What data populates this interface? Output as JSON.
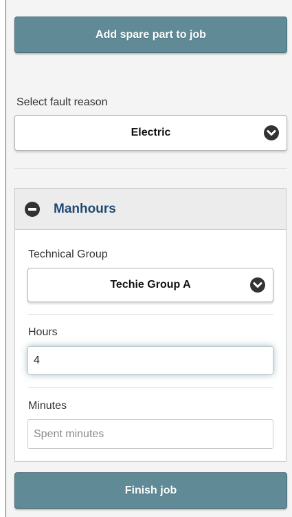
{
  "buttons": {
    "add_spare_part": "Add spare part to job",
    "finish_job": "Finish job"
  },
  "fault_reason": {
    "label": "Select fault reason",
    "selected": "Electric"
  },
  "manhours": {
    "title": "Manhours",
    "technical_group": {
      "label": "Technical Group",
      "selected": "Techie Group A"
    },
    "hours": {
      "label": "Hours",
      "value": "4"
    },
    "minutes": {
      "label": "Minutes",
      "value": "",
      "placeholder": "Spent minutes"
    }
  },
  "icons": {
    "dropdown": "chevron-down-circle-icon",
    "collapse": "minus-circle-icon"
  },
  "colors": {
    "button_bg": "#5f8a96",
    "manhours_title": "#1e4a73",
    "icon_dark": "#333333"
  }
}
